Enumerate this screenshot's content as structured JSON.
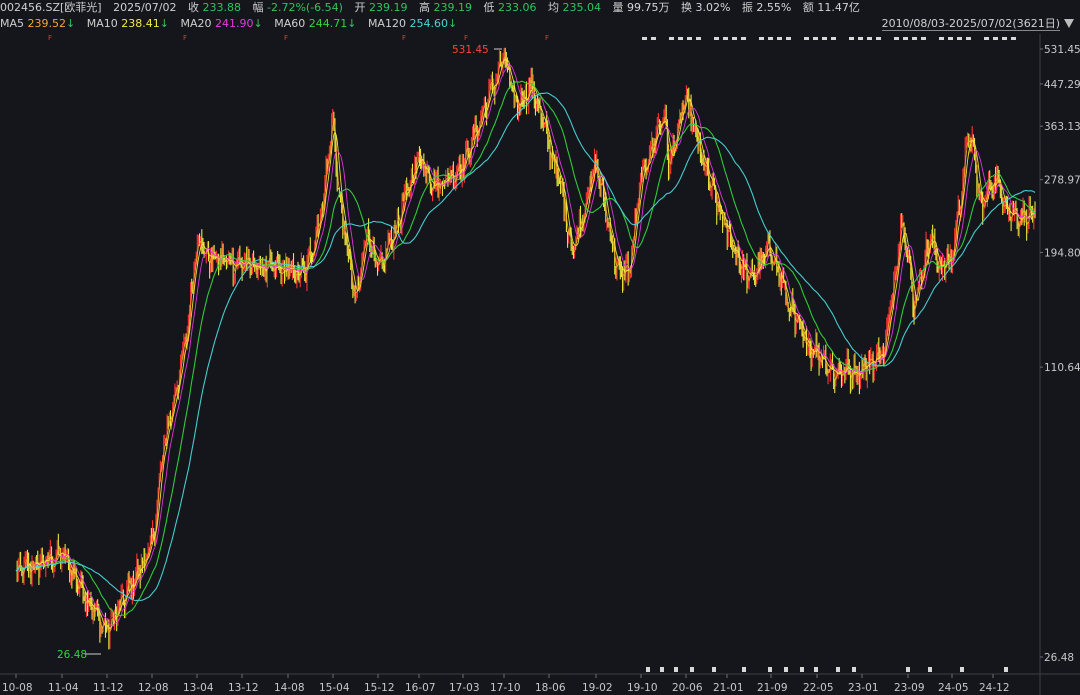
{
  "header": {
    "code": "002456.SZ[欧菲光]",
    "date": "2025/07/02",
    "close_label": "收",
    "close": "233.88",
    "change_label": "幅",
    "change": "-2.72%(-6.54)",
    "open_label": "开",
    "open": "239.19",
    "high_label": "高",
    "high": "239.19",
    "low_label": "低",
    "low": "233.06",
    "avg_label": "均",
    "avg": "235.04",
    "vol_label": "量",
    "vol": "99.75万",
    "turnover_label": "换",
    "turnover": "3.02%",
    "amplitude_label": "振",
    "amplitude": "2.55%",
    "amount_label": "额",
    "amount": "11.47亿"
  },
  "ma": [
    {
      "name": "MA5",
      "value": "239.52",
      "arrow": "↓",
      "color": "#f2a531"
    },
    {
      "name": "MA10",
      "value": "238.41",
      "arrow": "↓",
      "color": "#f7ea3c"
    },
    {
      "name": "MA20",
      "value": "241.90",
      "arrow": "↓",
      "color": "#e637e6"
    },
    {
      "name": "MA60",
      "value": "244.71",
      "arrow": "↓",
      "color": "#33d33b"
    },
    {
      "name": "MA120",
      "value": "254.60",
      "arrow": "↓",
      "color": "#48d6d6"
    }
  ],
  "range_label": "2010/08/03-2025/07/02(3621日)",
  "chart_data": {
    "type": "line",
    "y_scale": "log",
    "ylim": [
      20,
      560
    ],
    "y_ticks": [
      "531.45",
      "447.29",
      "363.13",
      "278.97",
      "194.80",
      "110.64",
      "26.48"
    ],
    "x_ticks": [
      "10-08",
      "11-04",
      "11-12",
      "12-08",
      "13-04",
      "13-12",
      "14-08",
      "15-04",
      "15-12",
      "16-07",
      "17-03",
      "17-10",
      "18-06",
      "19-02",
      "19-10",
      "20-06",
      "21-01",
      "21-09",
      "22-05",
      "23-01",
      "23-09",
      "24-05",
      "24-12"
    ],
    "annotations": [
      {
        "text": "531.45",
        "x": "17-10",
        "y": 531.45,
        "color": "#ff4040"
      },
      {
        "text": "26.48",
        "x": "11-12",
        "y": 26.48,
        "color": "#33d33b"
      }
    ],
    "price_knots": [
      [
        "10-08",
        40
      ],
      [
        "11-04",
        44
      ],
      [
        "11-12",
        30
      ],
      [
        "12-08",
        46
      ],
      [
        "12-10",
        74
      ],
      [
        "13-02",
        125
      ],
      [
        "13-04",
        210
      ],
      [
        "13-06",
        190
      ],
      [
        "13-12",
        185
      ],
      [
        "14-04",
        180
      ],
      [
        "14-08",
        178
      ],
      [
        "14-11",
        175
      ],
      [
        "15-02",
        240
      ],
      [
        "15-04",
        380
      ],
      [
        "15-05",
        260
      ],
      [
        "15-08",
        150
      ],
      [
        "15-10",
        222
      ],
      [
        "15-12",
        175
      ],
      [
        "16-03",
        220
      ],
      [
        "16-07",
        315
      ],
      [
        "16-10",
        270
      ],
      [
        "17-03",
        300
      ],
      [
        "17-08",
        440
      ],
      [
        "17-10",
        515
      ],
      [
        "17-12",
        400
      ],
      [
        "18-03",
        445
      ],
      [
        "18-06",
        330
      ],
      [
        "18-08",
        270
      ],
      [
        "18-10",
        195
      ],
      [
        "19-02",
        305
      ],
      [
        "19-06",
        175
      ],
      [
        "19-08",
        180
      ],
      [
        "19-10",
        280
      ],
      [
        "20-02",
        390
      ],
      [
        "20-03",
        300
      ],
      [
        "20-06",
        420
      ],
      [
        "20-09",
        300
      ],
      [
        "21-01",
        215
      ],
      [
        "21-05",
        170
      ],
      [
        "21-09",
        200
      ],
      [
        "21-12",
        150
      ],
      [
        "22-03",
        125
      ],
      [
        "22-05",
        120
      ],
      [
        "22-08",
        108
      ],
      [
        "23-01",
        110
      ],
      [
        "23-05",
        120
      ],
      [
        "23-08",
        235
      ],
      [
        "23-10",
        150
      ],
      [
        "24-01",
        210
      ],
      [
        "24-03",
        180
      ],
      [
        "24-05",
        190
      ],
      [
        "24-08",
        360
      ],
      [
        "24-10",
        240
      ],
      [
        "24-12",
        285
      ],
      [
        "25-03",
        235
      ],
      [
        "25-07",
        233.88
      ]
    ],
    "series": [
      {
        "name": "MA5",
        "color": "#f2a531"
      },
      {
        "name": "MA10",
        "color": "#f7ea3c"
      },
      {
        "name": "MA20",
        "color": "#e637e6"
      },
      {
        "name": "MA60",
        "color": "#33d33b"
      },
      {
        "name": "MA120",
        "color": "#48d6d6"
      }
    ],
    "candle_up_color": "#ff3333",
    "candle_down_color": "#e7e73a"
  }
}
